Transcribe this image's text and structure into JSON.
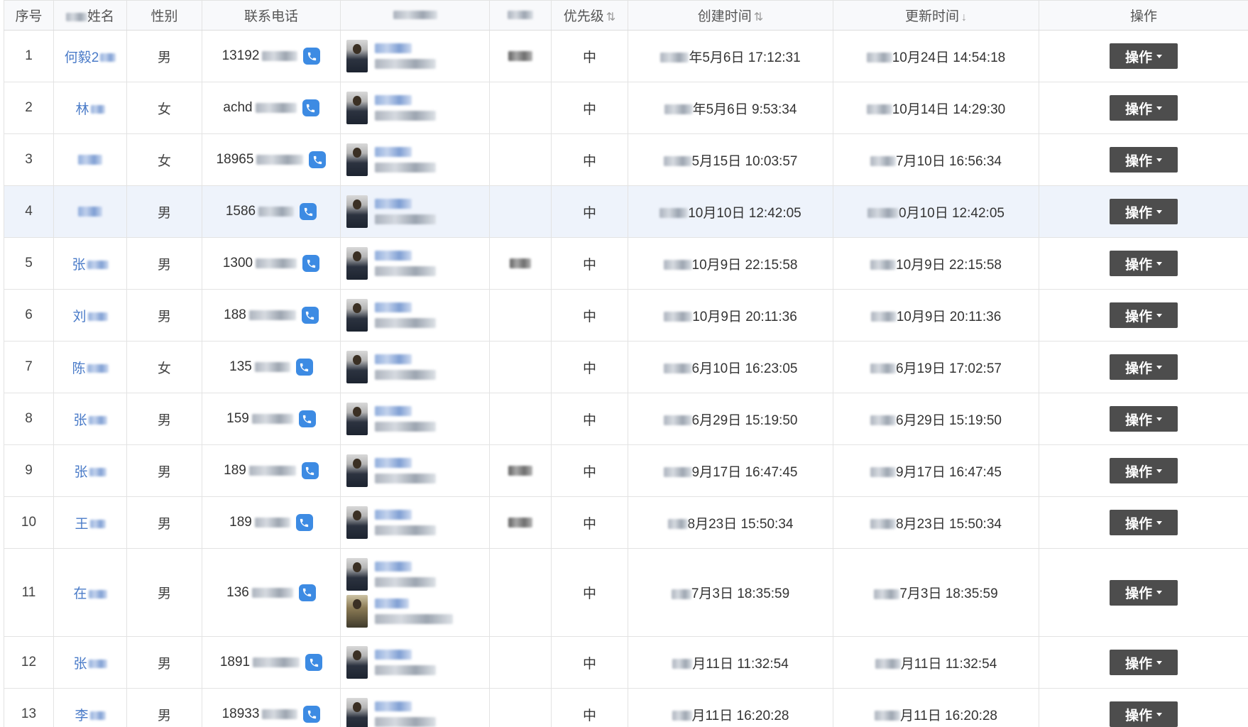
{
  "columns": {
    "index": "序号",
    "name": "姓名",
    "gender": "性别",
    "phone": "联系电话",
    "priority": "优先级",
    "priority_sort": "⇅",
    "created": "创建时间",
    "created_sort": "⇅",
    "updated": "更新时间",
    "updated_sort": "↓",
    "action": "操作"
  },
  "icons": {
    "phone": "phone-icon",
    "caret": "caret-down-icon"
  },
  "colors": {
    "link": "#4a7bc8",
    "phone_badge": "#3d8be3",
    "action_button": "#4d4d4d",
    "selected_row": "#eef3fb",
    "header_bg": "#f8f9fb"
  },
  "rows": [
    {
      "index": "1",
      "name": "何毅2",
      "gender": "男",
      "phone": "13192",
      "priority": "中",
      "created": "年5月6日 17:12:31",
      "updated": "10月24日 14:54:18",
      "action": "操作",
      "selected": false
    },
    {
      "index": "2",
      "name": "林",
      "gender": "女",
      "phone": "achd",
      "priority": "中",
      "created": "年5月6日 9:53:34",
      "updated": "10月14日 14:29:30",
      "action": "操作",
      "selected": false
    },
    {
      "index": "3",
      "name": "",
      "gender": "女",
      "phone": "18965",
      "priority": "中",
      "created": "5月15日 10:03:57",
      "updated": "7月10日 16:56:34",
      "action": "操作",
      "selected": false
    },
    {
      "index": "4",
      "name": "",
      "gender": "男",
      "phone": "1586",
      "priority": "中",
      "created": "10月10日 12:42:05",
      "updated": "0月10日 12:42:05",
      "action": "操作",
      "selected": true
    },
    {
      "index": "5",
      "name": "张",
      "gender": "男",
      "phone": "1300",
      "priority": "中",
      "created": "10月9日 22:15:58",
      "updated": "10月9日 22:15:58",
      "action": "操作",
      "selected": false
    },
    {
      "index": "6",
      "name": "刘",
      "gender": "男",
      "phone": "188",
      "priority": "中",
      "created": "10月9日 20:11:36",
      "updated": "10月9日 20:11:36",
      "action": "操作",
      "selected": false
    },
    {
      "index": "7",
      "name": "陈",
      "gender": "女",
      "phone": "135",
      "priority": "中",
      "created": "6月10日 16:23:05",
      "updated": "6月19日 17:02:57",
      "action": "操作",
      "selected": false
    },
    {
      "index": "8",
      "name": "张",
      "gender": "男",
      "phone": "159",
      "priority": "中",
      "created": "6月29日 15:19:50",
      "updated": "6月29日 15:19:50",
      "action": "操作",
      "selected": false
    },
    {
      "index": "9",
      "name": "张",
      "gender": "男",
      "phone": "189",
      "priority": "中",
      "created": "9月17日 16:47:45",
      "updated": "9月17日 16:47:45",
      "action": "操作",
      "selected": false
    },
    {
      "index": "10",
      "name": "王",
      "gender": "男",
      "phone": "189",
      "priority": "中",
      "created": "8月23日 15:50:34",
      "updated": "8月23日 15:50:34",
      "action": "操作",
      "selected": false
    },
    {
      "index": "11",
      "name": "在",
      "gender": "男",
      "phone": "136",
      "priority": "中",
      "created": "7月3日 18:35:59",
      "updated": "7月3日 18:35:59",
      "action": "操作",
      "selected": false
    },
    {
      "index": "12",
      "name": "张",
      "gender": "男",
      "phone": "1891",
      "priority": "中",
      "created": "月11日 11:32:54",
      "updated": "月11日 11:32:54",
      "action": "操作",
      "selected": false
    },
    {
      "index": "13",
      "name": "李",
      "gender": "男",
      "phone": "18933",
      "priority": "中",
      "created": "月11日 16:20:28",
      "updated": "月11日 16:20:28",
      "action": "操作",
      "selected": false
    }
  ]
}
